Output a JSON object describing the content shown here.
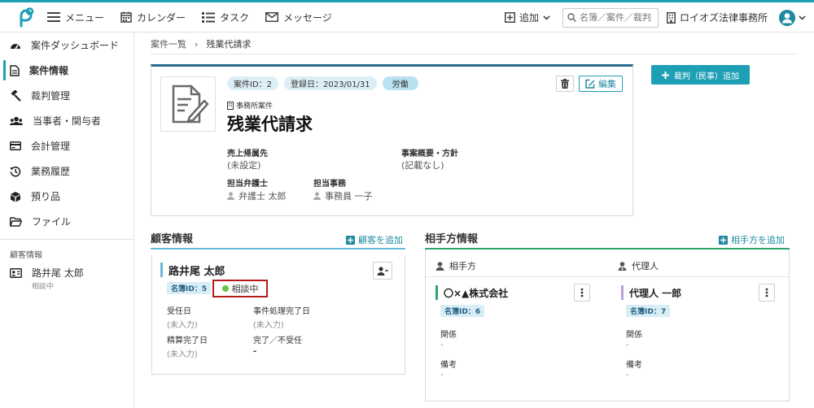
{
  "nav": {
    "menu": "メニュー",
    "calendar": "カレンダー",
    "task": "タスク",
    "message": "メッセージ",
    "add": "追加",
    "search_placeholder": "名簿／案件／裁判",
    "firm": "ロイオズ法律事務所"
  },
  "sidebar": {
    "items": [
      {
        "label": "案件ダッシュボード",
        "icon": "dashboard-icon"
      },
      {
        "label": "案件情報",
        "icon": "document-icon"
      },
      {
        "label": "裁判管理",
        "icon": "gavel-icon"
      },
      {
        "label": "当事者・関与者",
        "icon": "users-icon"
      },
      {
        "label": "会計管理",
        "icon": "credit-card-icon"
      },
      {
        "label": "業務履歴",
        "icon": "history-icon"
      },
      {
        "label": "預り品",
        "icon": "box-icon"
      },
      {
        "label": "ファイル",
        "icon": "folder-icon"
      }
    ],
    "section_label": "顧客情報",
    "client_name": "路井尾 太郎",
    "client_status": "相談中"
  },
  "breadcrumb": {
    "parent": "案件一覧",
    "sep": "›",
    "current": "残業代請求"
  },
  "case": {
    "id_badge": "案件ID：2",
    "date_badge": "登録日：2023/01/31",
    "category_badge": "労働",
    "office_tag": "事務所案件",
    "title": "残業代請求",
    "edit_label": "編集",
    "sales_label": "売上帰属先",
    "sales_value": "(未設定)",
    "summary_label": "事案概要・方針",
    "summary_value": "(記載なし)",
    "lawyer_label": "担当弁護士",
    "lawyer_value": "弁護士 太郎",
    "staff_label": "担当事務",
    "staff_value": "事務員 一子"
  },
  "add_court_label": "裁判（民事）追加",
  "client": {
    "section_title": "顧客情報",
    "add_link": "顧客を追加",
    "name": "路井尾 太郎",
    "nameid": "名簿ID：5",
    "status": "相談中",
    "received_label": "受任日",
    "received_value": "(未入力)",
    "completed_label": "事件処理完了日",
    "completed_value": "(未入力)",
    "settled_label": "精算完了日",
    "settled_value": "(未入力)",
    "result_label": "完了／不受任",
    "result_value": "-"
  },
  "opponent": {
    "section_title": "相手方情報",
    "add_link": "相手方を追加",
    "col_party": "相手方",
    "col_agent": "代理人",
    "party_name": "〇×▲株式会社",
    "party_nameid": "名簿ID：6",
    "agent_name": "代理人 一郎",
    "agent_nameid": "名簿ID：7",
    "relation_label": "関係",
    "relation_value": "-",
    "note_label": "備考",
    "note_value": "-"
  },
  "colors": {
    "accent": "#1e9fb6",
    "case_border": "#2c6d8f",
    "status_dot": "#6cc24a",
    "highlight": "#b41a1a",
    "opp_party_bar": "#2fa36b",
    "opp_agent_bar": "#b9a0d8"
  }
}
